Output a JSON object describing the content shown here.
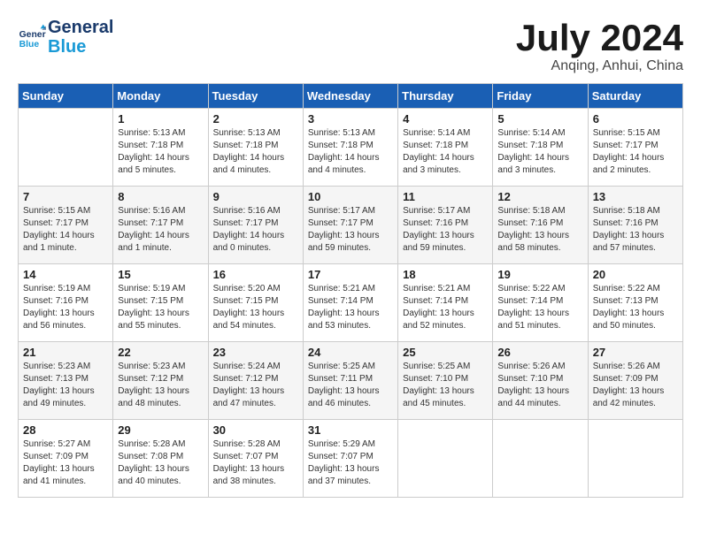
{
  "header": {
    "logo_line1": "General",
    "logo_line2": "Blue",
    "month_title": "July 2024",
    "subtitle": "Anqing, Anhui, China"
  },
  "weekdays": [
    "Sunday",
    "Monday",
    "Tuesday",
    "Wednesday",
    "Thursday",
    "Friday",
    "Saturday"
  ],
  "weeks": [
    [
      {
        "day": "",
        "detail": ""
      },
      {
        "day": "1",
        "detail": "Sunrise: 5:13 AM\nSunset: 7:18 PM\nDaylight: 14 hours\nand 5 minutes."
      },
      {
        "day": "2",
        "detail": "Sunrise: 5:13 AM\nSunset: 7:18 PM\nDaylight: 14 hours\nand 4 minutes."
      },
      {
        "day": "3",
        "detail": "Sunrise: 5:13 AM\nSunset: 7:18 PM\nDaylight: 14 hours\nand 4 minutes."
      },
      {
        "day": "4",
        "detail": "Sunrise: 5:14 AM\nSunset: 7:18 PM\nDaylight: 14 hours\nand 3 minutes."
      },
      {
        "day": "5",
        "detail": "Sunrise: 5:14 AM\nSunset: 7:18 PM\nDaylight: 14 hours\nand 3 minutes."
      },
      {
        "day": "6",
        "detail": "Sunrise: 5:15 AM\nSunset: 7:17 PM\nDaylight: 14 hours\nand 2 minutes."
      }
    ],
    [
      {
        "day": "7",
        "detail": "Sunrise: 5:15 AM\nSunset: 7:17 PM\nDaylight: 14 hours\nand 1 minute."
      },
      {
        "day": "8",
        "detail": "Sunrise: 5:16 AM\nSunset: 7:17 PM\nDaylight: 14 hours\nand 1 minute."
      },
      {
        "day": "9",
        "detail": "Sunrise: 5:16 AM\nSunset: 7:17 PM\nDaylight: 14 hours\nand 0 minutes."
      },
      {
        "day": "10",
        "detail": "Sunrise: 5:17 AM\nSunset: 7:17 PM\nDaylight: 13 hours\nand 59 minutes."
      },
      {
        "day": "11",
        "detail": "Sunrise: 5:17 AM\nSunset: 7:16 PM\nDaylight: 13 hours\nand 59 minutes."
      },
      {
        "day": "12",
        "detail": "Sunrise: 5:18 AM\nSunset: 7:16 PM\nDaylight: 13 hours\nand 58 minutes."
      },
      {
        "day": "13",
        "detail": "Sunrise: 5:18 AM\nSunset: 7:16 PM\nDaylight: 13 hours\nand 57 minutes."
      }
    ],
    [
      {
        "day": "14",
        "detail": "Sunrise: 5:19 AM\nSunset: 7:16 PM\nDaylight: 13 hours\nand 56 minutes."
      },
      {
        "day": "15",
        "detail": "Sunrise: 5:19 AM\nSunset: 7:15 PM\nDaylight: 13 hours\nand 55 minutes."
      },
      {
        "day": "16",
        "detail": "Sunrise: 5:20 AM\nSunset: 7:15 PM\nDaylight: 13 hours\nand 54 minutes."
      },
      {
        "day": "17",
        "detail": "Sunrise: 5:21 AM\nSunset: 7:14 PM\nDaylight: 13 hours\nand 53 minutes."
      },
      {
        "day": "18",
        "detail": "Sunrise: 5:21 AM\nSunset: 7:14 PM\nDaylight: 13 hours\nand 52 minutes."
      },
      {
        "day": "19",
        "detail": "Sunrise: 5:22 AM\nSunset: 7:14 PM\nDaylight: 13 hours\nand 51 minutes."
      },
      {
        "day": "20",
        "detail": "Sunrise: 5:22 AM\nSunset: 7:13 PM\nDaylight: 13 hours\nand 50 minutes."
      }
    ],
    [
      {
        "day": "21",
        "detail": "Sunrise: 5:23 AM\nSunset: 7:13 PM\nDaylight: 13 hours\nand 49 minutes."
      },
      {
        "day": "22",
        "detail": "Sunrise: 5:23 AM\nSunset: 7:12 PM\nDaylight: 13 hours\nand 48 minutes."
      },
      {
        "day": "23",
        "detail": "Sunrise: 5:24 AM\nSunset: 7:12 PM\nDaylight: 13 hours\nand 47 minutes."
      },
      {
        "day": "24",
        "detail": "Sunrise: 5:25 AM\nSunset: 7:11 PM\nDaylight: 13 hours\nand 46 minutes."
      },
      {
        "day": "25",
        "detail": "Sunrise: 5:25 AM\nSunset: 7:10 PM\nDaylight: 13 hours\nand 45 minutes."
      },
      {
        "day": "26",
        "detail": "Sunrise: 5:26 AM\nSunset: 7:10 PM\nDaylight: 13 hours\nand 44 minutes."
      },
      {
        "day": "27",
        "detail": "Sunrise: 5:26 AM\nSunset: 7:09 PM\nDaylight: 13 hours\nand 42 minutes."
      }
    ],
    [
      {
        "day": "28",
        "detail": "Sunrise: 5:27 AM\nSunset: 7:09 PM\nDaylight: 13 hours\nand 41 minutes."
      },
      {
        "day": "29",
        "detail": "Sunrise: 5:28 AM\nSunset: 7:08 PM\nDaylight: 13 hours\nand 40 minutes."
      },
      {
        "day": "30",
        "detail": "Sunrise: 5:28 AM\nSunset: 7:07 PM\nDaylight: 13 hours\nand 38 minutes."
      },
      {
        "day": "31",
        "detail": "Sunrise: 5:29 AM\nSunset: 7:07 PM\nDaylight: 13 hours\nand 37 minutes."
      },
      {
        "day": "",
        "detail": ""
      },
      {
        "day": "",
        "detail": ""
      },
      {
        "day": "",
        "detail": ""
      }
    ]
  ]
}
